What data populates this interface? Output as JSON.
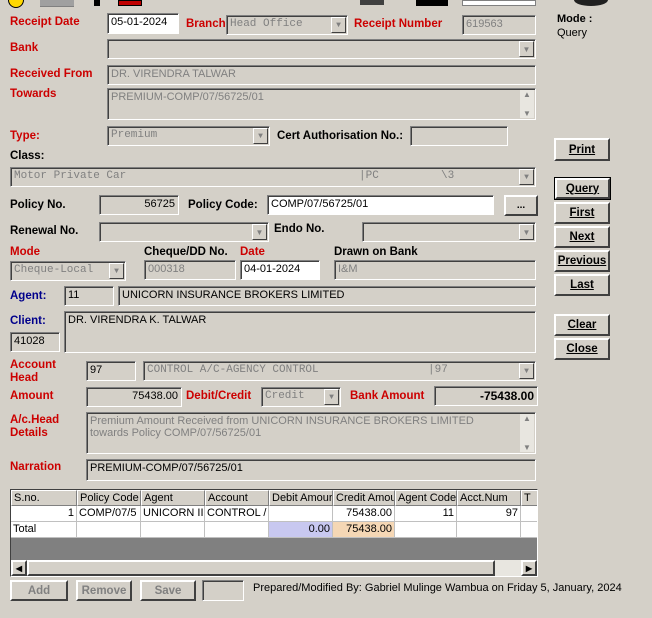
{
  "toolbar": {
    "items": [
      "toolbar-icon-1",
      "toolbar-icon-2",
      "toolbar-icon-3",
      "toolbar-icon-4"
    ]
  },
  "mode": {
    "label": "Mode :",
    "value": "Query"
  },
  "receipt_date": {
    "label": "Receipt Date",
    "value": "05-01-2024"
  },
  "branch": {
    "label": "Branch",
    "value": "Head Office"
  },
  "receipt_number": {
    "label": "Receipt Number",
    "value": "619563"
  },
  "bank": {
    "label": "Bank",
    "value": ""
  },
  "received_from": {
    "label": "Received From",
    "value": "DR. VIRENDRA TALWAR"
  },
  "towards": {
    "label": "Towards",
    "value": "PREMIUM-COMP/07/56725/01"
  },
  "type": {
    "label": "Type:",
    "value": "Premium"
  },
  "cert_auth": {
    "label": "Cert Authorisation No.:",
    "value": ""
  },
  "class": {
    "label": "Class:",
    "value": "Motor Private Car",
    "code": "|PC",
    "num": "\\3"
  },
  "policy_no": {
    "label": "Policy No.",
    "value": "56725"
  },
  "policy_code": {
    "label": "Policy Code:",
    "value": "COMP/07/56725/01"
  },
  "ellipsis_label": "...",
  "renewal_no": {
    "label": "Renewal No.",
    "value": ""
  },
  "endo_no": {
    "label": "Endo No.",
    "value": ""
  },
  "mode_pay": {
    "label": "Mode",
    "value": "Cheque-Local"
  },
  "cheque_dd": {
    "label": "Cheque/DD No.",
    "value": "000318"
  },
  "date": {
    "label": "Date",
    "value": "04-01-2024"
  },
  "drawn_on": {
    "label": "Drawn on Bank",
    "value": "I&M"
  },
  "agent": {
    "label": "Agent:",
    "code": "11",
    "name": "UNICORN INSURANCE BROKERS LIMITED"
  },
  "client": {
    "label": "Client:",
    "code": "41028",
    "name": "DR. VIRENDRA K. TALWAR"
  },
  "account_head": {
    "label": "Account Head",
    "code": "97",
    "name": "CONTROL A/C-AGENCY CONTROL",
    "num": "|97"
  },
  "amount": {
    "label": "Amount",
    "value": "75438.00"
  },
  "debit_credit": {
    "label": "Debit/Credit",
    "value": "Credit"
  },
  "bank_amount": {
    "label": "Bank Amount",
    "value": "-75438.00"
  },
  "ac_head_details": {
    "label": "A/c.Head Details",
    "value": "Premium Amount Received from UNICORN INSURANCE BROKERS LIMITED towards Policy COMP/07/56725/01"
  },
  "narration": {
    "label": "Narration",
    "value": "PREMIUM-COMP/07/56725/01"
  },
  "buttons": {
    "print": "Print",
    "query": "Query",
    "first": "First",
    "next": "Next",
    "previous": "Previous",
    "last": "Last",
    "clear": "Clear",
    "close": "Close",
    "add": "Add",
    "remove": "Remove",
    "save": "Save"
  },
  "grid": {
    "headers": [
      "S.no.",
      "Policy Code",
      "Agent",
      "Account",
      "Debit Amour",
      "Credit Amou",
      "Agent Code",
      "Acct.Num",
      "T"
    ],
    "rows": [
      [
        "1",
        "COMP/07/5",
        "UNICORN II",
        "CONTROL /",
        "",
        "75438.00",
        "11",
        "97",
        ""
      ]
    ],
    "total_row": [
      "Total",
      "",
      "",
      "",
      "0.00",
      "75438.00",
      "",
      "",
      ""
    ]
  },
  "footer": {
    "prepared_by": "Prepared/Modified By: Gabriel Mulinge Wambua on Friday 5, January, 2024"
  },
  "colors": {
    "label_red": "#cc0000",
    "debit_total_bg": "#c8c8f0",
    "credit_total_bg": "#f5d7b5"
  }
}
